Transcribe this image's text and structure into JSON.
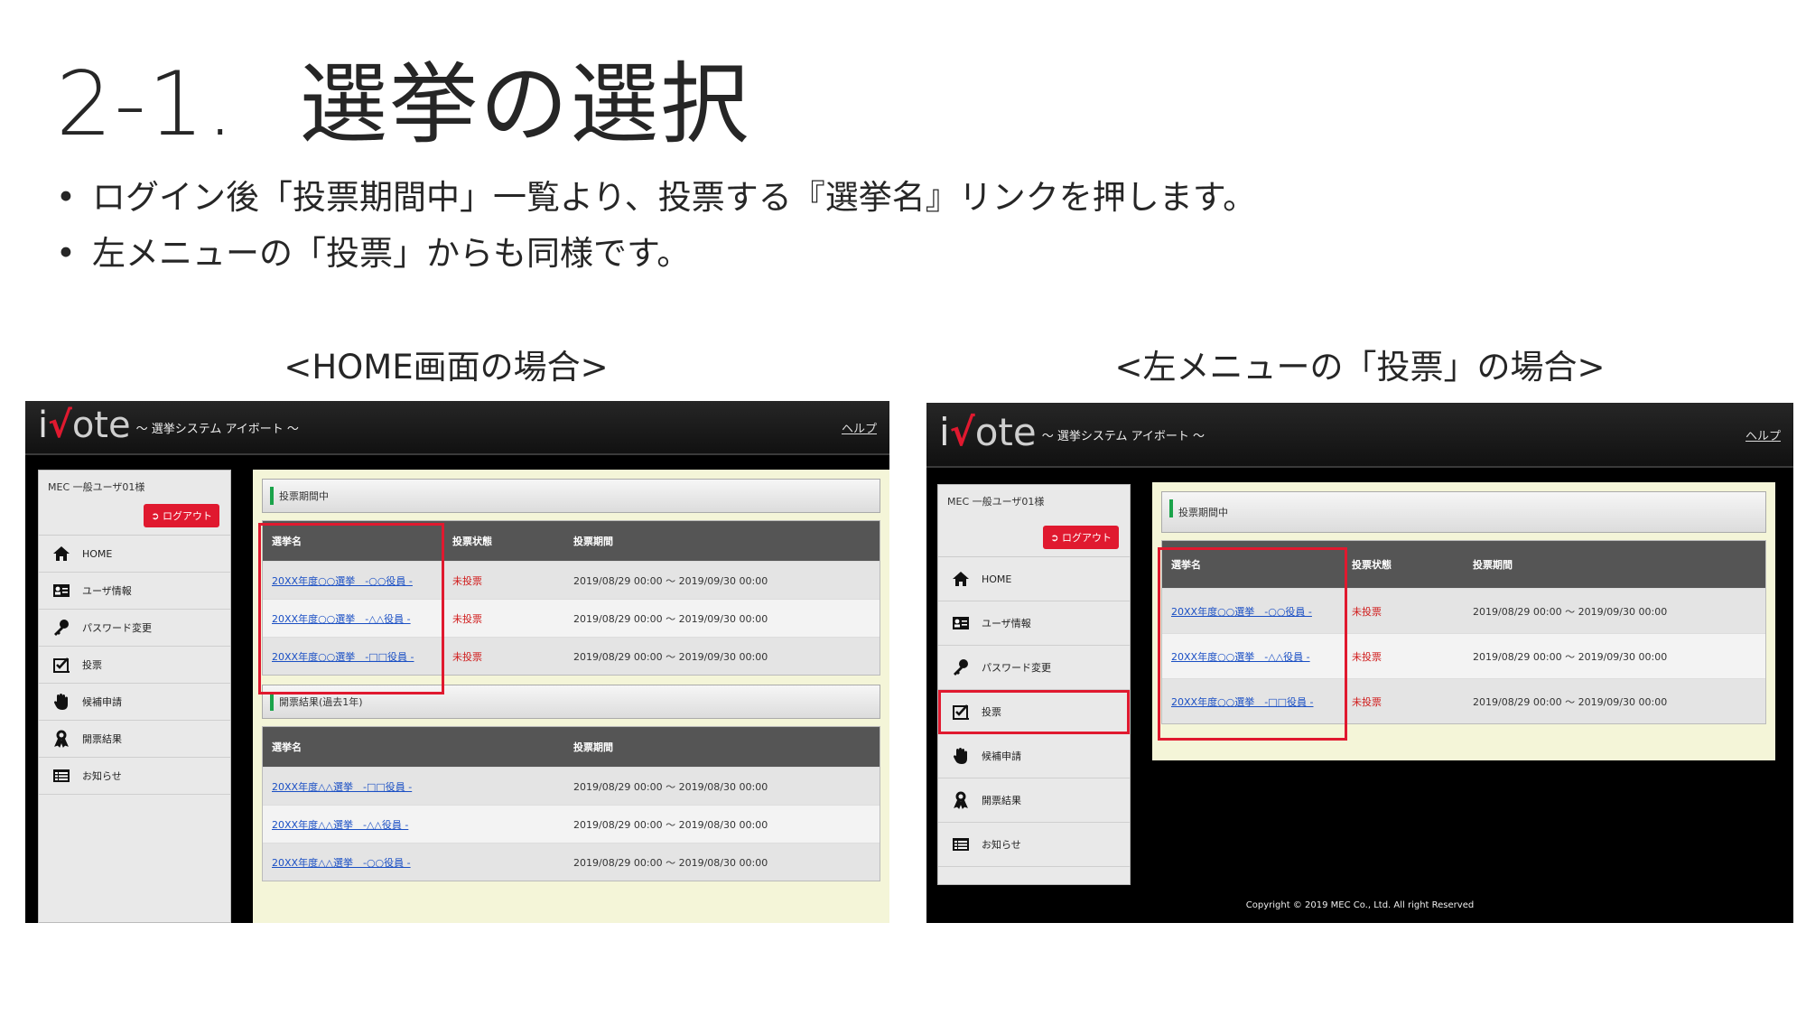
{
  "slide": {
    "title_num": "2-1.",
    "title_text": "選挙の選択",
    "bullets": [
      "ログイン後「投票期間中」一覧より、投票する『選挙名』リンクを押します。",
      "左メニューの「投票」からも同様です。"
    ],
    "caption_left": "<HOME画面の場合>",
    "caption_right": "<左メニューの「投票」の場合>"
  },
  "app": {
    "logo_i": "i",
    "logo_v": "√",
    "logo_ote": "ote",
    "logo_sub": "～ 選挙システム アイボート ～",
    "help": "ヘルプ",
    "user": "MEC 一般ユーザ01様",
    "logout": "ログアウト",
    "menu": [
      {
        "label": "HOME",
        "icon": "home-icon"
      },
      {
        "label": "ユーザ情報",
        "icon": "user-card-icon"
      },
      {
        "label": "パスワード変更",
        "icon": "key-icon"
      },
      {
        "label": "投票",
        "icon": "ballot-check-icon"
      },
      {
        "label": "候補申請",
        "icon": "hand-icon"
      },
      {
        "label": "開票結果",
        "icon": "ribbon-icon"
      },
      {
        "label": "お知らせ",
        "icon": "list-icon"
      }
    ],
    "panel_voting": "投票期間中",
    "panel_results": "開票結果(過去1年)",
    "col_name": "選挙名",
    "col_status": "投票状態",
    "col_period": "投票期間",
    "voting_rows": [
      {
        "name": "20XX年度○○選挙　-○○役員 -",
        "status": "未投票",
        "period": "2019/08/29 00:00 ～ 2019/09/30 00:00"
      },
      {
        "name": "20XX年度○○選挙　-△△役員 -",
        "status": "未投票",
        "period": "2019/08/29 00:00 ～ 2019/09/30 00:00"
      },
      {
        "name": "20XX年度○○選挙　-□□役員 -",
        "status": "未投票",
        "period": "2019/08/29 00:00 ～ 2019/09/30 00:00"
      }
    ],
    "result_rows": [
      {
        "name": "20XX年度△△選挙　-□□役員 -",
        "period": "2019/08/29 00:00 ～ 2019/08/30 00:00"
      },
      {
        "name": "20XX年度△△選挙　-△△役員 -",
        "period": "2019/08/29 00:00 ～ 2019/08/30 00:00"
      },
      {
        "name": "20XX年度△△選挙　-○○役員 -",
        "period": "2019/08/29 00:00 ～ 2019/08/30 00:00"
      }
    ],
    "copyright": "Copyright © 2019 MEC Co., Ltd. All right Reserved"
  },
  "colors": {
    "accent_red": "#e0192f",
    "link_blue": "#1a4fc4",
    "panel_bg": "#f4f5d8",
    "header_green": "#1aa34a"
  }
}
